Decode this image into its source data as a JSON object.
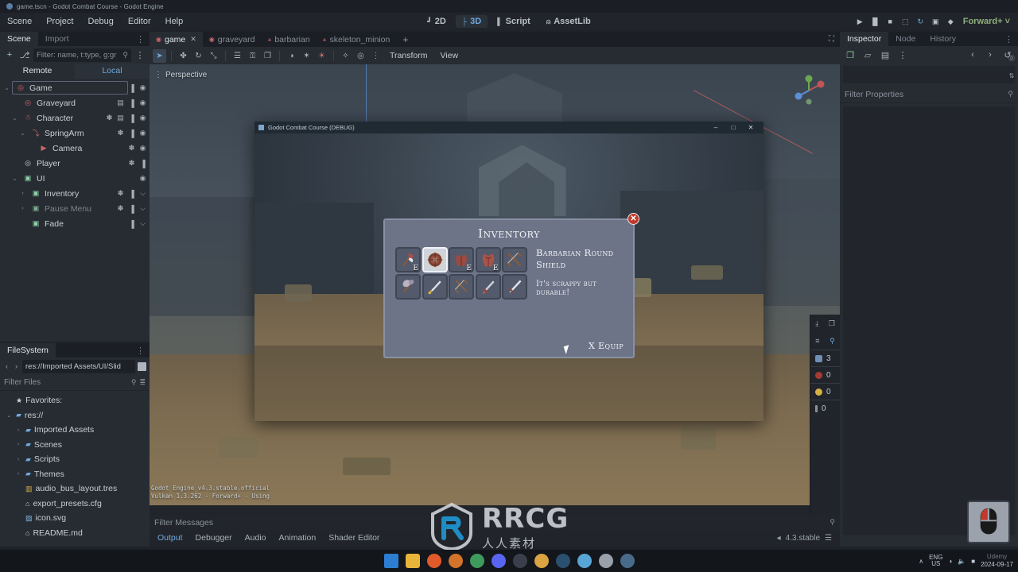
{
  "os": {
    "title": "game.tscn - Godot Combat Course - Godot Engine",
    "window_icon": "godot-icon"
  },
  "menubar": {
    "items": [
      {
        "label": "Scene"
      },
      {
        "label": "Project"
      },
      {
        "label": "Debug"
      },
      {
        "label": "Editor"
      },
      {
        "label": "Help"
      }
    ]
  },
  "main_tabs": [
    {
      "label": "2D",
      "icon": "2d-icon",
      "active": false
    },
    {
      "label": "3D",
      "icon": "3d-icon",
      "active": true
    },
    {
      "label": "Script",
      "icon": "script-icon",
      "active": false
    },
    {
      "label": "AssetLib",
      "icon": "assetlib-icon",
      "active": false
    }
  ],
  "play_controls": {
    "buttons": [
      {
        "name": "run-project-icon",
        "glyph": "▶"
      },
      {
        "name": "pause-icon",
        "glyph": "▐▌"
      },
      {
        "name": "stop-icon",
        "glyph": "■"
      },
      {
        "name": "movie-writer-icon",
        "glyph": "⬚"
      },
      {
        "name": "reload-icon",
        "glyph": "↻"
      },
      {
        "name": "play-scene-icon",
        "glyph": "▣"
      },
      {
        "name": "play-custom-scene-icon",
        "glyph": "◆"
      }
    ],
    "renderer": "Forward+",
    "renderer_caret": "˅"
  },
  "scene_dock": {
    "tabs": [
      {
        "label": "Scene",
        "active": true
      },
      {
        "label": "Import",
        "active": false
      }
    ],
    "more_glyph": "⋮",
    "toolbar": {
      "add_node": "+",
      "instance_child": "⎇",
      "filter_placeholder": "Filter: name, t:type, g:gr",
      "search_icon": "search-icon",
      "more": "⋮"
    },
    "remote_local": [
      {
        "label": "Remote",
        "active": false
      },
      {
        "label": "Local",
        "active": true
      }
    ],
    "tree": [
      {
        "label": "Game",
        "indent": 0,
        "arrow": "⌄",
        "icon": "node3d-icon",
        "icon_color": "#d06868",
        "selected": true,
        "dim": false,
        "rights": [
          "script",
          "visibility"
        ]
      },
      {
        "label": "Graveyard",
        "indent": 1,
        "arrow": "",
        "icon": "node3d-icon",
        "icon_color": "#d06868",
        "selected": false,
        "dim": false,
        "rights": [
          "scene",
          "script",
          "visibility"
        ]
      },
      {
        "label": "Character",
        "indent": 1,
        "arrow": "⌄",
        "icon": "character-icon",
        "icon_color": "#d06868",
        "selected": false,
        "dim": false,
        "rights": [
          "signal",
          "scene",
          "script",
          "visibility"
        ]
      },
      {
        "label": "SpringArm",
        "indent": 2,
        "arrow": "⌄",
        "icon": "springarm-icon",
        "icon_color": "#d06868",
        "selected": false,
        "dim": false,
        "rights": [
          "signal",
          "script",
          "visibility"
        ]
      },
      {
        "label": "Camera",
        "indent": 3,
        "arrow": "",
        "icon": "camera-icon",
        "icon_color": "#d06868",
        "selected": false,
        "dim": false,
        "rights": [
          "signal",
          "visibility"
        ]
      },
      {
        "label": "Player",
        "indent": 1,
        "arrow": "",
        "icon": "node3d-icon",
        "icon_color": "#c9ced6",
        "selected": false,
        "dim": false,
        "rights": [
          "signal",
          "script"
        ]
      },
      {
        "label": "UI",
        "indent": 1,
        "arrow": "⌄",
        "icon": "control-icon",
        "icon_color": "#8fd3a8",
        "selected": false,
        "dim": false,
        "rights": [
          "visibility"
        ]
      },
      {
        "label": "Inventory",
        "indent": 2,
        "arrow": "›",
        "icon": "control-icon",
        "icon_color": "#8fd3a8",
        "selected": false,
        "dim": false,
        "rights": [
          "signal",
          "script",
          "collapse"
        ]
      },
      {
        "label": "Pause Menu",
        "indent": 2,
        "arrow": "›",
        "icon": "control-icon",
        "icon_color": "#7fae8e",
        "selected": false,
        "dim": true,
        "rights": [
          "signal",
          "script",
          "collapse"
        ]
      },
      {
        "label": "Fade",
        "indent": 2,
        "arrow": "",
        "icon": "control-icon",
        "icon_color": "#8fd3a8",
        "selected": false,
        "dim": false,
        "rights": [
          "script",
          "collapse"
        ]
      }
    ]
  },
  "filesystem_dock": {
    "tabs": [
      {
        "label": "FileSystem",
        "active": true
      }
    ],
    "more_glyph": "⋮",
    "path": "res://Imported Assets/UI/Slid",
    "nav_back": "‹",
    "nav_forward": "›",
    "filter_placeholder": "Filter Files",
    "search_icon": "search-icon",
    "sort_icon": "sort-icon",
    "entries": [
      {
        "label": "Favorites:",
        "indent": 0,
        "type": "favorites",
        "expander": ""
      },
      {
        "label": "res://",
        "indent": 0,
        "type": "folder",
        "expander": "⌄"
      },
      {
        "label": "Imported Assets",
        "indent": 1,
        "type": "folder",
        "expander": "›"
      },
      {
        "label": "Scenes",
        "indent": 1,
        "type": "folder",
        "expander": "›"
      },
      {
        "label": "Scripts",
        "indent": 1,
        "type": "folder",
        "expander": "›"
      },
      {
        "label": "Themes",
        "indent": 1,
        "type": "folder",
        "expander": "›"
      },
      {
        "label": "audio_bus_layout.tres",
        "indent": 1,
        "type": "resource",
        "expander": ""
      },
      {
        "label": "export_presets.cfg",
        "indent": 1,
        "type": "config",
        "expander": ""
      },
      {
        "label": "icon.svg",
        "indent": 1,
        "type": "image",
        "expander": ""
      },
      {
        "label": "README.md",
        "indent": 1,
        "type": "config",
        "expander": ""
      }
    ]
  },
  "scene_tabs": [
    {
      "label": "game",
      "active": true,
      "closable": true
    },
    {
      "label": "graveyard",
      "active": false,
      "closable": false
    },
    {
      "label": "barbarian",
      "active": false,
      "closable": false
    },
    {
      "label": "skeleton_minion",
      "active": false,
      "closable": false
    }
  ],
  "scene_tabs_plus": "+",
  "scene_tabs_expand": "⛶",
  "view_toolbar": {
    "buttons": [
      {
        "name": "select-mode-icon",
        "glyph": "➤",
        "active": true
      },
      {
        "name": "move-mode-icon",
        "glyph": "✤",
        "active": false
      },
      {
        "name": "rotate-mode-icon",
        "glyph": "↻",
        "active": false
      },
      {
        "name": "scale-mode-icon",
        "glyph": "⤡",
        "active": false
      },
      {
        "name": "list-select-icon",
        "glyph": "☰",
        "active": false
      },
      {
        "name": "lock-icon",
        "glyph": "⚿",
        "active": false
      },
      {
        "name": "group-icon",
        "glyph": "❐",
        "active": false
      },
      {
        "name": "ruler-icon",
        "glyph": "◑",
        "active": false
      },
      {
        "name": "snap-icon",
        "glyph": "✶",
        "active": false
      },
      {
        "name": "light-icon",
        "glyph": "☀",
        "active": false
      },
      {
        "name": "gizmo-icon",
        "glyph": "✧",
        "active": false
      },
      {
        "name": "preview-sun-icon",
        "glyph": "◎",
        "active": false
      },
      {
        "name": "more-options-icon",
        "glyph": "⋮",
        "active": false
      }
    ],
    "menus": [
      {
        "label": "Transform"
      },
      {
        "label": "View"
      }
    ]
  },
  "viewport": {
    "label": "Perspective",
    "label_menu_icon": "⋮",
    "engine_info_line1": "Godot Engine v4.3.stable.official",
    "engine_info_line2": "Vulkan 1.3.262 - Forward+ - Using"
  },
  "debug_strip": {
    "top_icons": [
      {
        "name": "export-icon",
        "glyph": "⤓"
      },
      {
        "name": "copy-icon",
        "glyph": "❐"
      },
      {
        "name": "filter-icon",
        "glyph": "≡"
      },
      {
        "name": "search-icon",
        "glyph": "⚲"
      }
    ],
    "counters": [
      {
        "name": "messages-count",
        "value": "3",
        "color": "#6f8fb5"
      },
      {
        "name": "errors-count",
        "value": "0",
        "color": "#c0392b"
      },
      {
        "name": "warnings-count",
        "value": "0",
        "color": "#d4b045"
      },
      {
        "name": "info-count",
        "value": "0",
        "color": "#8a919b"
      }
    ]
  },
  "inspector_dock": {
    "tabs": [
      {
        "label": "Inspector",
        "active": true
      },
      {
        "label": "Node",
        "active": false
      },
      {
        "label": "History",
        "active": false
      }
    ],
    "more_glyph": "⋮",
    "toolbar": [
      {
        "name": "new-resource-icon",
        "glyph": "❐"
      },
      {
        "name": "load-resource-icon",
        "glyph": "▱"
      },
      {
        "name": "save-resource-icon",
        "glyph": "▤"
      },
      {
        "name": "resource-menu-icon",
        "glyph": "⋮"
      }
    ],
    "nav": [
      {
        "name": "history-prev-icon",
        "glyph": "‹"
      },
      {
        "name": "history-next-icon",
        "glyph": "›"
      },
      {
        "name": "history-list-icon",
        "glyph": "↺"
      }
    ],
    "side_icons": [
      {
        "name": "open-docs-icon",
        "glyph": "Ⓓ"
      },
      {
        "name": "toggle-sort-icon",
        "glyph": "⇅"
      }
    ],
    "filter_placeholder": "Filter Properties",
    "search_icon": "search-icon"
  },
  "bottom_panel": {
    "filter_placeholder": "Filter Messages",
    "search_icon": "search-icon",
    "tabs": [
      {
        "label": "Output",
        "active": true
      },
      {
        "label": "Debugger",
        "active": false
      },
      {
        "label": "Audio",
        "active": false
      },
      {
        "label": "Animation",
        "active": false
      },
      {
        "label": "Shader Editor",
        "active": false
      }
    ],
    "status_version": "4.3.stable",
    "status_icon": "☰",
    "status_prefix": "◂"
  },
  "mouse_indicator": {
    "name": "mouse-left-button-indicator",
    "active_button": "left",
    "active_color": "#c0392b"
  },
  "game_window": {
    "title": "Godot Combat Course (DEBUG)",
    "controls": [
      {
        "name": "minimize-button",
        "glyph": "–"
      },
      {
        "name": "maximize-button",
        "glyph": "□"
      },
      {
        "name": "close-button",
        "glyph": "✕"
      }
    ],
    "inventory": {
      "title": "Inventory",
      "close_glyph": "✕",
      "selected_item_name": "Barbarian Round Shield",
      "selected_item_desc": "It's scrappy but durable!",
      "equip_label": "X Equip",
      "slots": [
        {
          "index": 0,
          "item": "battle-axe",
          "badge": "E",
          "selected": false
        },
        {
          "index": 1,
          "item": "round-shield",
          "badge": "",
          "selected": true
        },
        {
          "index": 2,
          "item": "leather-armor",
          "badge": "E",
          "selected": false
        },
        {
          "index": 3,
          "item": "chest-armor",
          "badge": "E",
          "selected": false
        },
        {
          "index": 4,
          "item": "crossbow",
          "badge": "",
          "selected": false
        },
        {
          "index": 5,
          "item": "war-hammer",
          "badge": "",
          "selected": false
        },
        {
          "index": 6,
          "item": "gold-dagger",
          "badge": "",
          "selected": false
        },
        {
          "index": 7,
          "item": "crossbow-2",
          "badge": "",
          "selected": false
        },
        {
          "index": 8,
          "item": "short-sword",
          "badge": "",
          "selected": false
        },
        {
          "index": 9,
          "item": "long-sword",
          "badge": "",
          "selected": false
        }
      ]
    }
  },
  "watermark": {
    "text": "RRCG",
    "sub": "人人素材"
  },
  "taskbar": {
    "icons": [
      {
        "name": "start-button",
        "color": "#2d7dd2"
      },
      {
        "name": "file-explorer-icon",
        "color": "#e8b339"
      },
      {
        "name": "firefox-icon",
        "color": "#e05a2b"
      },
      {
        "name": "brave-icon",
        "color": "#d4742a"
      },
      {
        "name": "app-green-icon",
        "color": "#3f9a5e"
      },
      {
        "name": "discord-icon",
        "color": "#5865f2"
      },
      {
        "name": "obs-icon",
        "color": "#3a3f4b"
      },
      {
        "name": "file-app-icon",
        "color": "#d9a441"
      },
      {
        "name": "blender-icon",
        "color": "#2b4f6e"
      },
      {
        "name": "notepad-icon",
        "color": "#58a6d6"
      },
      {
        "name": "settings-icon",
        "color": "#9aa1ab"
      },
      {
        "name": "godot-taskbar-icon",
        "color": "#486b8a"
      }
    ],
    "tray": {
      "chevron": "∧",
      "lang_line1": "ENG",
      "lang_line2": "US",
      "wifi": "wifi-icon",
      "volume": "volume-icon",
      "battery": "battery-icon",
      "date": "2024-09-17",
      "brand": "Udemy"
    }
  }
}
